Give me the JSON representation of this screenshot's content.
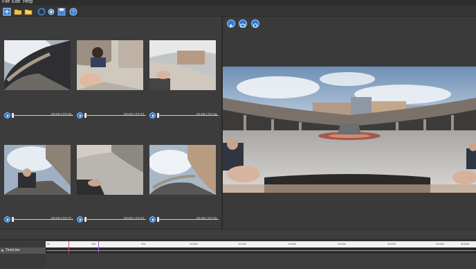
{
  "menu": {
    "file": "File",
    "edit": "Edit",
    "help": "Help"
  },
  "toolbar": {
    "buttons": [
      "new-project-icon",
      "open-folder-icon",
      "open-file-icon",
      "refresh-icon",
      "settings-icon",
      "save-icon",
      "help-icon"
    ]
  },
  "videos": [
    {
      "time": "00:00 / 03:24"
    },
    {
      "time": "00:00 / 03:22"
    },
    {
      "time": "00:00 / 03:24"
    },
    {
      "time": "00:00 / 03:27"
    },
    {
      "time": "00:00 / 03:07"
    },
    {
      "time": "00:00 / 03:29"
    }
  ],
  "preview": {
    "buttons": [
      "play-icon",
      "fit-window-icon",
      "reset-view-icon"
    ]
  },
  "timeline": {
    "track_label": "TimeLine",
    "ruler_labels": [
      "0s",
      "10s",
      "20s",
      "1m00s",
      "1m20s",
      "1m40s",
      "2m00s",
      "2m20s",
      "2m40s",
      "3m00s"
    ],
    "colors": {
      "marker_red": "#e0506a",
      "marker_purple": "#9a5fd0"
    }
  }
}
